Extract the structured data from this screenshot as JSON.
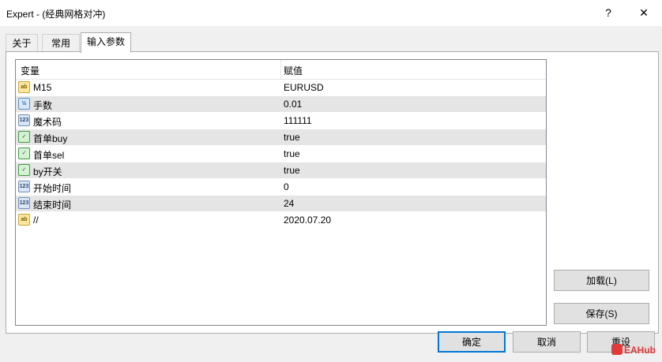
{
  "window": {
    "title": "Expert -   (经典网格对冲)",
    "help_glyph": "?",
    "close_glyph": "✕"
  },
  "tabs": [
    {
      "label": "关于"
    },
    {
      "label": "常用"
    },
    {
      "label": "输入参数",
      "active": true
    }
  ],
  "table": {
    "headers": {
      "name": "变量",
      "value": "赋值"
    },
    "rows": [
      {
        "type": "ab",
        "icon_text": "ab",
        "name": "M15",
        "value": "EURUSD"
      },
      {
        "type": "dbl",
        "icon_text": "½",
        "name": "手数",
        "value": "0.01"
      },
      {
        "type": "int",
        "icon_text": "123",
        "name": "魔术码",
        "value": "111111"
      },
      {
        "type": "bool",
        "icon_text": "✓",
        "name": "首单buy",
        "value": "true"
      },
      {
        "type": "bool",
        "icon_text": "✓",
        "name": "首单sel",
        "value": "true"
      },
      {
        "type": "bool",
        "icon_text": "✓",
        "name": "by开关",
        "value": "true"
      },
      {
        "type": "int",
        "icon_text": "123",
        "name": "开始时间",
        "value": "0"
      },
      {
        "type": "int",
        "icon_text": "123",
        "name": "结束时间",
        "value": "24"
      },
      {
        "type": "ab",
        "icon_text": "ab",
        "name": "//",
        "value": "2020.07.20"
      }
    ]
  },
  "side_buttons": {
    "load": "加载(L)",
    "save": "保存(S)"
  },
  "footer_buttons": {
    "ok": "确定",
    "cancel": "取消",
    "reset": "重设"
  },
  "watermark": {
    "text": "EAHub"
  }
}
